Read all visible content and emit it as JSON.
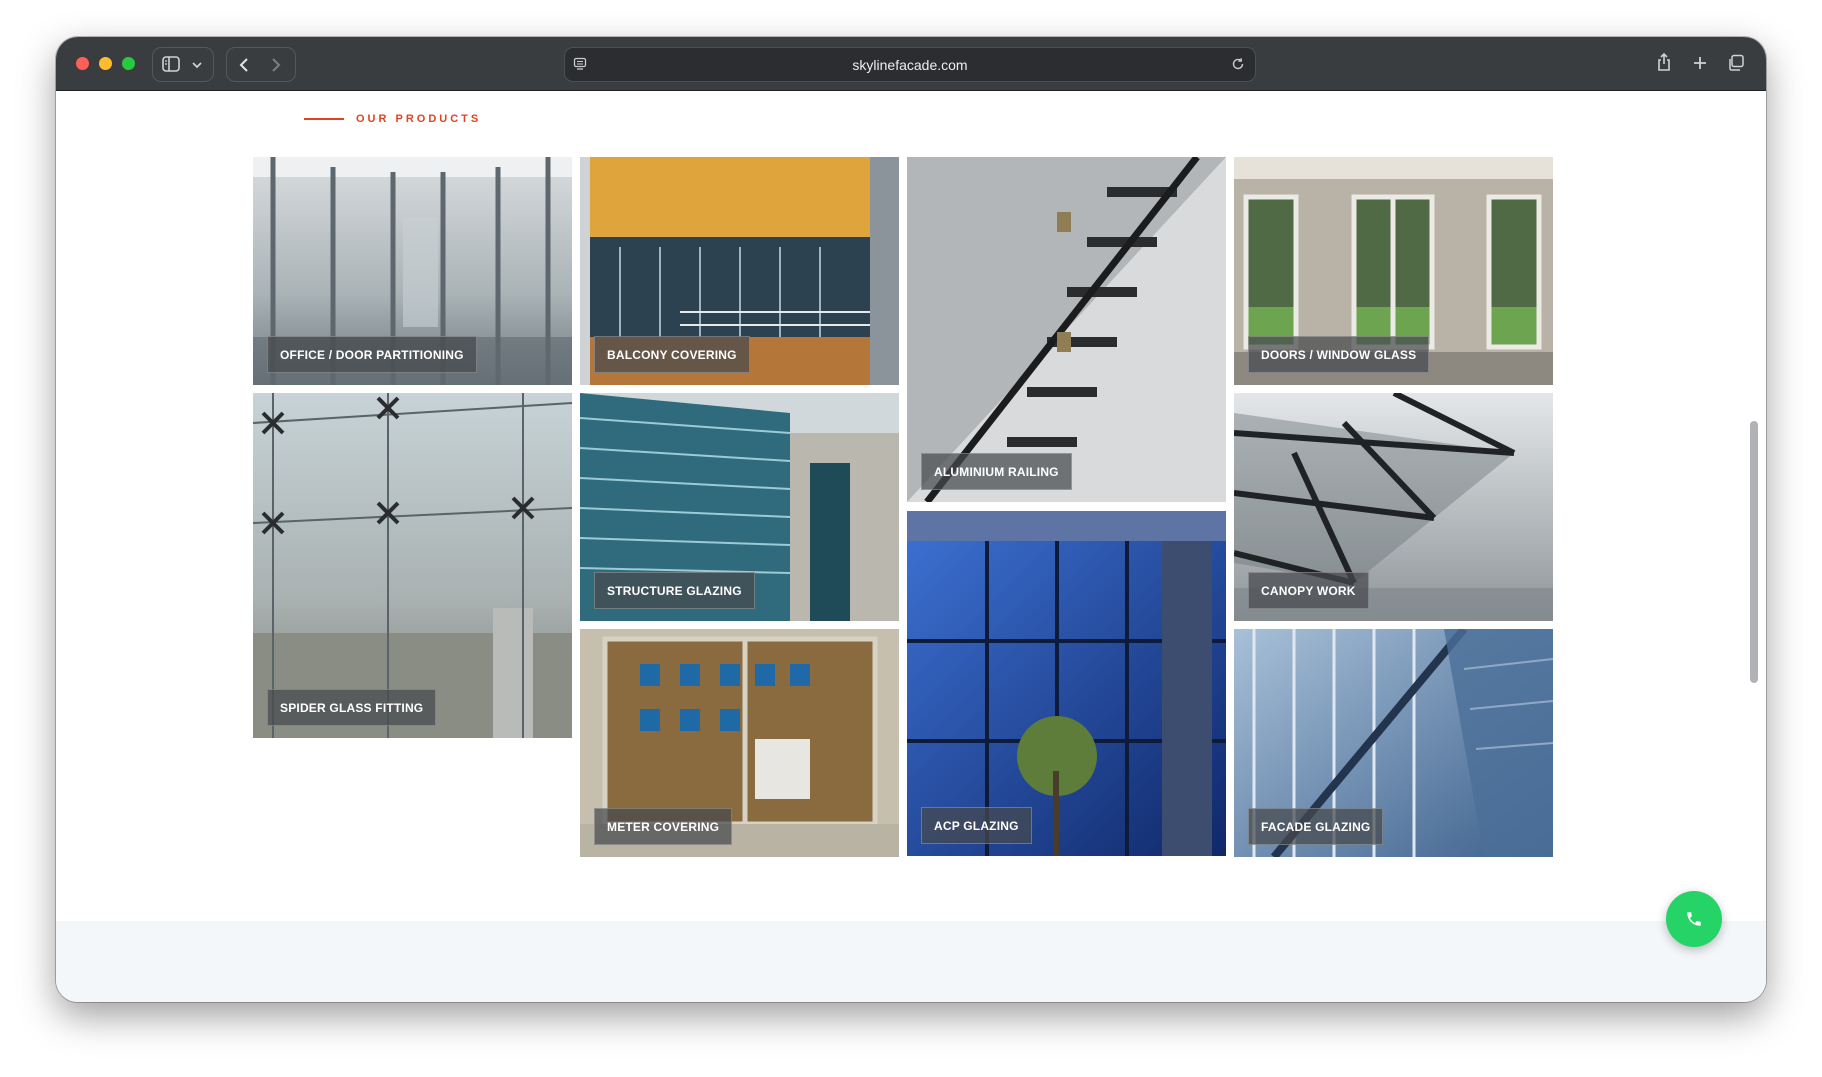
{
  "browser": {
    "url": "skylinefacade.com"
  },
  "section": {
    "label": "OUR PRODUCTS"
  },
  "products": [
    {
      "label": "OFFICE / DOOR PARTITIONING"
    },
    {
      "label": "BALCONY COVERING"
    },
    {
      "label": "ALUMINIUM RAILING"
    },
    {
      "label": "DOORS / WINDOW GLASS"
    },
    {
      "label": "SPIDER GLASS FITTING"
    },
    {
      "label": "STRUCTURE GLAZING"
    },
    {
      "label": "CANOPY WORK"
    },
    {
      "label": "METER COVERING"
    },
    {
      "label": "ACP GLAZING"
    },
    {
      "label": "FACADE GLAZING"
    }
  ],
  "colors": {
    "accent": "#e0431f",
    "toolbar": "#3a3d40",
    "whatsapp": "#25d366"
  }
}
